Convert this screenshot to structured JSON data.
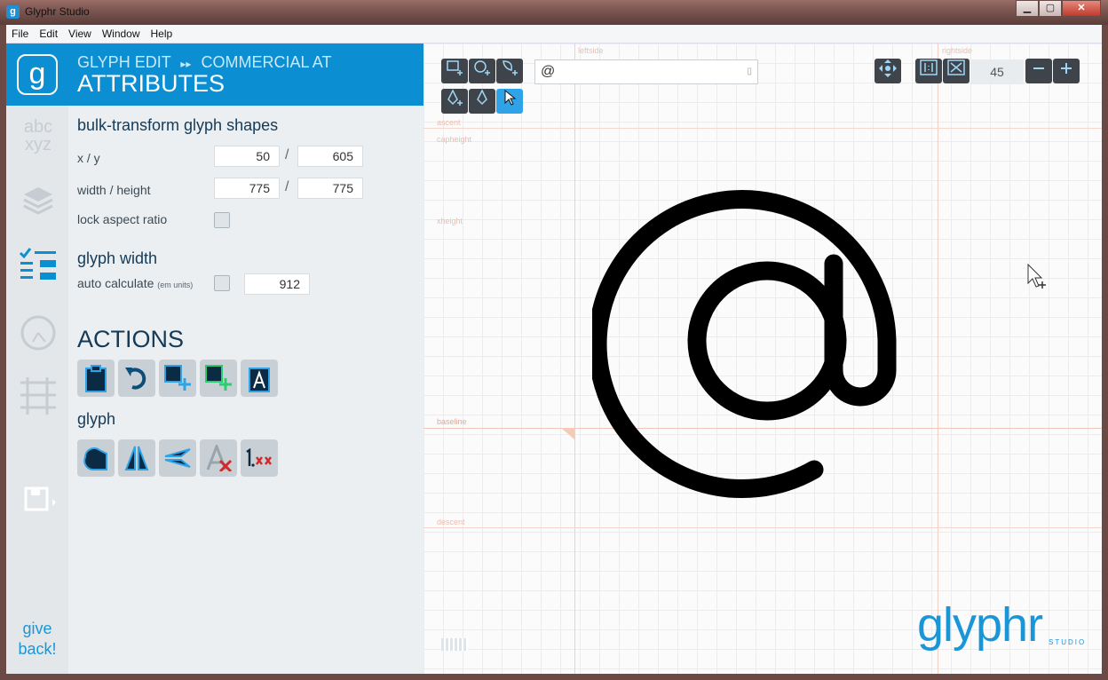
{
  "window": {
    "title": "Glyphr Studio",
    "icon": "glyphr-app-icon",
    "controls": {
      "minimize": "▁",
      "maximize": "▢",
      "close": "✕"
    }
  },
  "menubar": {
    "items": [
      "File",
      "Edit",
      "Window",
      "Help"
    ],
    "view_label": "View"
  },
  "nav": {
    "logo": "g",
    "icons": [
      "glyph-chooser-icon",
      "layers-icon",
      "attributes-icon",
      "guides-icon",
      "grid-icon",
      "save-icon"
    ],
    "give_back": "give back!"
  },
  "panel": {
    "breadcrumb_left": "GLYPH EDIT",
    "breadcrumb_sep": "▸▸",
    "breadcrumb_right": "COMMERCIAL AT",
    "title": "ATTRIBUTES",
    "bulk_heading": "bulk-transform glyph shapes",
    "xy_label": "x / y",
    "x_value": "50",
    "y_value": "605",
    "wh_label": "width / height",
    "width_value": "775",
    "height_value": "775",
    "slash": "/",
    "lock_label": "lock aspect ratio",
    "glyph_width_heading": "glyph width",
    "auto_calc_label": "auto calculate",
    "em_units": "(em units)",
    "glyph_width_value": "912",
    "actions_heading": "ACTIONS",
    "glyph_heading": "glyph",
    "action_buttons": [
      "paste-icon",
      "undo-icon",
      "add-shape-icon",
      "add-component-icon",
      "paste-attributes-icon"
    ],
    "glyph_buttons": [
      "combine-shapes-icon",
      "flip-icon",
      "flip-horizontal-icon",
      "clear-glyph-icon",
      "round-values-icon"
    ]
  },
  "canvas": {
    "glyph_char": "@",
    "guides": {
      "leftside": "leftside",
      "rightside": "rightside",
      "ascent": "ascent",
      "capheight": "capheight",
      "xheight": "xheight",
      "baseline": "baseline",
      "descent": "descent"
    },
    "zoom": "45",
    "brand": "glyphr",
    "brand_sub": "STUDIO"
  }
}
